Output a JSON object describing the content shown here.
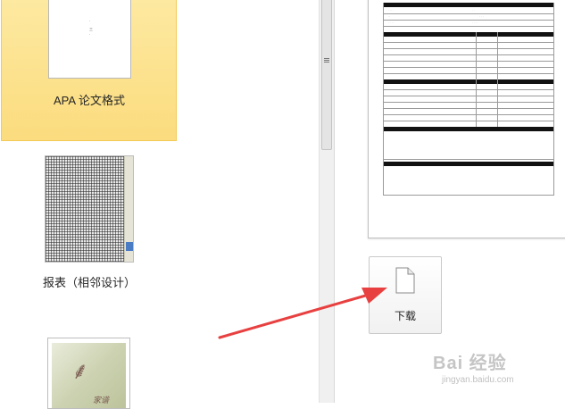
{
  "templates": [
    {
      "label": "APA 论文格式",
      "selected": true
    },
    {
      "label": "报表（相邻设计）",
      "selected": false
    },
    {
      "label": "",
      "thumb_text": "家谱",
      "selected": false
    }
  ],
  "preview": {
    "download_label": "下载",
    "download_icon": "document-icon"
  },
  "watermark": {
    "logo": "Bai 经验",
    "url": "jingyan.baidu.com"
  },
  "colors": {
    "selected_bg": "#fbdc7e",
    "arrow": "#e84040"
  }
}
